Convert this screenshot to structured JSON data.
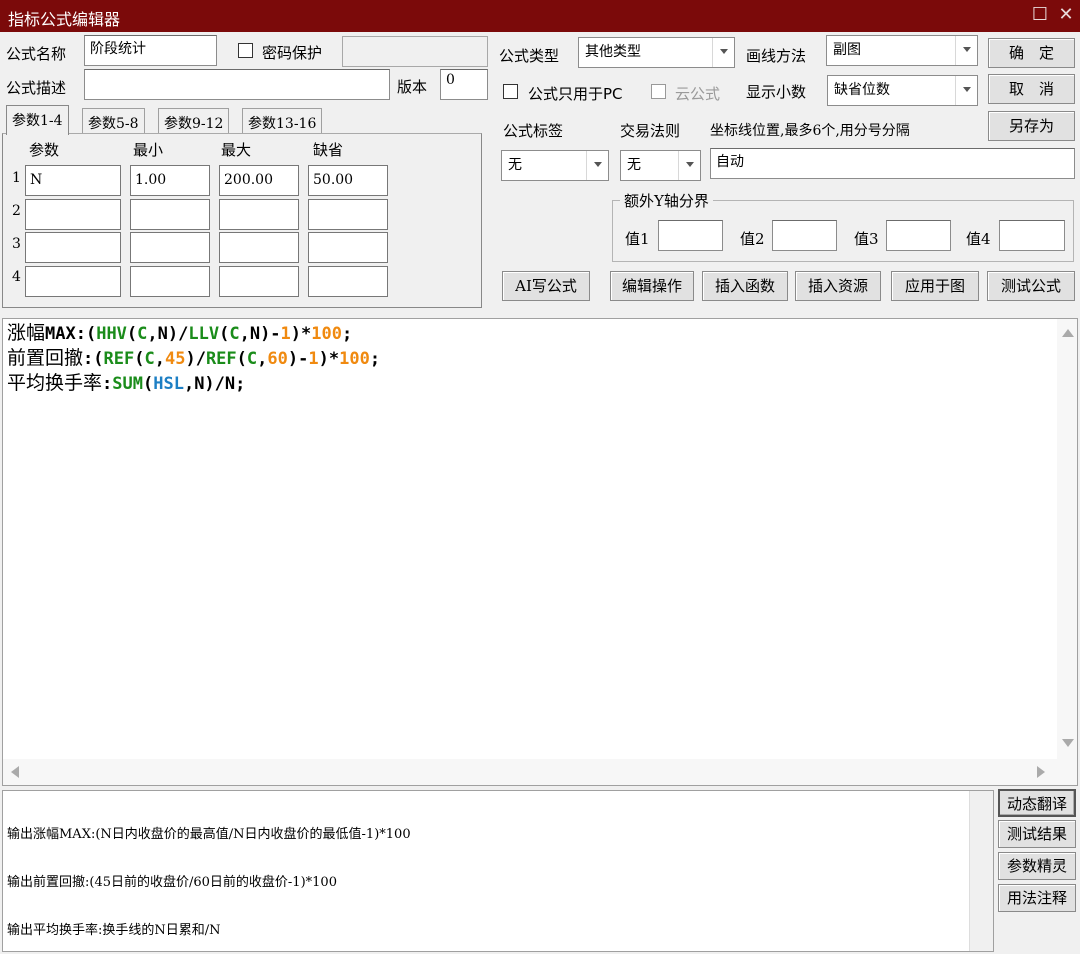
{
  "window": {
    "title": "指标公式编辑器"
  },
  "form": {
    "name_label": "公式名称",
    "name_value": "阶段统计",
    "password_label": "密码保护",
    "desc_label": "公式描述",
    "desc_value": "",
    "version_label": "版本",
    "version_value": "0",
    "type_label": "公式类型",
    "type_value": "其他类型",
    "draw_label": "画线方法",
    "draw_value": "副图",
    "pc_only_label": "公式只用于PC",
    "cloud_label": "云公式",
    "decimal_label": "显示小数",
    "decimal_value": "缺省位数",
    "tag_label": "公式标签",
    "tag_value": "无",
    "trade_label": "交易法则",
    "trade_value": "无",
    "coord_label": "坐标线位置,最多6个,用分号分隔",
    "coord_value": "自动",
    "extra_y_label": "额外Y轴分界",
    "values": [
      "值1",
      "值2",
      "值3",
      "值4"
    ]
  },
  "buttons": {
    "ok": "确　定",
    "cancel": "取　消",
    "save_as": "另存为",
    "ai": "AI写公式",
    "edit_ops": "编辑操作",
    "insert_fn": "插入函数",
    "insert_res": "插入资源",
    "apply": "应用于图",
    "test": "测试公式"
  },
  "tabs": [
    "参数1-4",
    "参数5-8",
    "参数9-12",
    "参数13-16"
  ],
  "params": {
    "headers": [
      "参数",
      "最小",
      "最大",
      "缺省"
    ],
    "rows": [
      {
        "num": "1",
        "name": "N",
        "min": "1.00",
        "max": "200.00",
        "def": "50.00"
      },
      {
        "num": "2",
        "name": "",
        "min": "",
        "max": "",
        "def": ""
      },
      {
        "num": "3",
        "name": "",
        "min": "",
        "max": "",
        "def": ""
      },
      {
        "num": "4",
        "name": "",
        "min": "",
        "max": "",
        "def": ""
      }
    ]
  },
  "code": [
    {
      "cn": "涨幅",
      "tokens": [
        [
          "MAX:(",
          ""
        ],
        [
          "HHV",
          "fn"
        ],
        [
          "(",
          ""
        ],
        [
          "C",
          "arg"
        ],
        [
          ",N)/",
          ""
        ],
        [
          "LLV",
          "fn"
        ],
        [
          "(",
          ""
        ],
        [
          "C",
          "arg"
        ],
        [
          ",N)-",
          ""
        ],
        [
          "1",
          "num"
        ],
        [
          ")*",
          ""
        ],
        [
          "100",
          "num"
        ],
        [
          ";",
          ""
        ]
      ]
    },
    {
      "cn": "前置回撤",
      "tokens": [
        [
          ":(",
          ""
        ],
        [
          "REF",
          "fn"
        ],
        [
          "(",
          ""
        ],
        [
          "C",
          "arg"
        ],
        [
          ",",
          ""
        ],
        [
          "45",
          "num"
        ],
        [
          ")/",
          ""
        ],
        [
          "REF",
          "fn"
        ],
        [
          "(",
          ""
        ],
        [
          "C",
          "arg"
        ],
        [
          ",",
          ""
        ],
        [
          "60",
          "num"
        ],
        [
          ")-",
          ""
        ],
        [
          "1",
          "num"
        ],
        [
          ")*",
          ""
        ],
        [
          "100",
          "num"
        ],
        [
          ";",
          ""
        ]
      ]
    },
    {
      "cn": "平均换手率",
      "tokens": [
        [
          ":",
          ""
        ],
        [
          "SUM",
          "fn"
        ],
        [
          "(",
          ""
        ],
        [
          "HSL",
          "hsl"
        ],
        [
          ",N)/N;",
          ""
        ]
      ]
    }
  ],
  "output": {
    "lines": [
      "输出涨幅MAX:(N日内收盘价的最高值/N日内收盘价的最低值-1)*100",
      "输出前置回撤:(45日前的收盘价/60日前的收盘价-1)*100",
      "输出平均换手率:换手线的N日累和/N"
    ]
  },
  "side_buttons": [
    "动态翻译",
    "测试结果",
    "参数精灵",
    "用法注释"
  ]
}
